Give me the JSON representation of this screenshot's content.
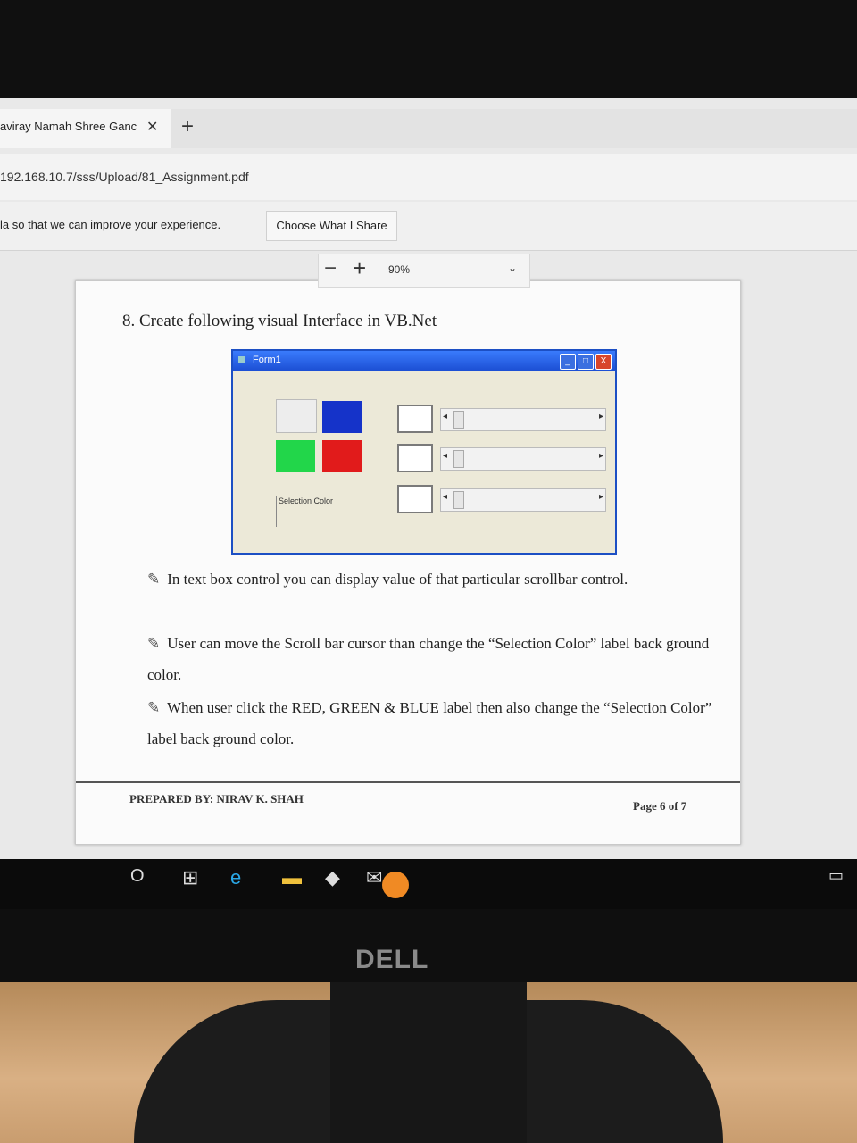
{
  "browser": {
    "tab_title": "aviray Namah Shree Ganc",
    "tab_close": "✕",
    "new_tab": "+",
    "url": "192.168.10.7/sss/Upload/81_Assignment.pdf",
    "notice_text": "la so that we can improve your experience.",
    "notice_button": "Choose What I Share"
  },
  "pdf_toolbar": {
    "zoom_out": "−",
    "zoom_in": "+",
    "zoom_level": "90%",
    "dropdown": "⌄"
  },
  "document": {
    "heading": "8. Create following visual Interface in VB.Net",
    "form": {
      "title": "Form1",
      "min": "_",
      "max": "□",
      "close": "X",
      "selection_label": "Selection Color",
      "colors": {
        "blue": "#1533c9",
        "green": "#22d64a",
        "red": "#e11b1b"
      }
    },
    "bullets": [
      "In text box control you can display value of that particular scrollbar control.",
      "User can move the Scroll bar cursor than change the “Selection Color” label back ground color.",
      "When user click the RED, GREEN & BLUE label then also change the “Selection Color” label back ground color."
    ],
    "footer_left": "PREPARED BY: NIRAV K. SHAH",
    "footer_right": "Page 6 of 7"
  },
  "taskbar": {
    "search": "O",
    "task_view": "⊞",
    "edge": "e",
    "files": "▬",
    "store": "◆",
    "mail": "✉",
    "notifications": "▭"
  },
  "monitor": {
    "brand": "DELL"
  }
}
